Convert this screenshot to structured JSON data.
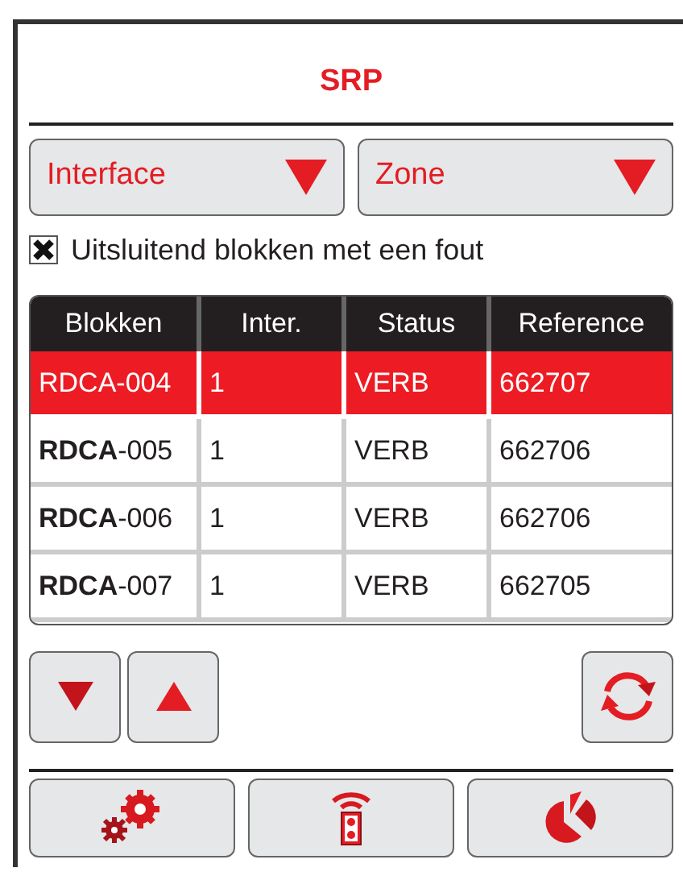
{
  "title": "SRP",
  "dropdowns": [
    {
      "label": "Interface"
    },
    {
      "label": "Zone"
    }
  ],
  "filter": {
    "label": "Uitsluitend blokken met een fout",
    "checked": true
  },
  "table": {
    "columns": [
      "Blokken",
      "Inter.",
      "Status",
      "Reference"
    ],
    "rows": [
      {
        "cells": [
          "RDCA-004",
          "1",
          "VERB",
          "662707"
        ],
        "selected": true
      },
      {
        "cells": [
          "**RDCA**-005",
          "1",
          "VERB",
          "662706"
        ],
        "selected": false
      },
      {
        "cells": [
          "**RDCA**-006",
          "1",
          "VERB",
          "662706"
        ],
        "selected": false
      },
      {
        "cells": [
          "**RDCA**-007",
          "1",
          "VERB",
          "662705"
        ],
        "selected": false
      }
    ]
  }
}
